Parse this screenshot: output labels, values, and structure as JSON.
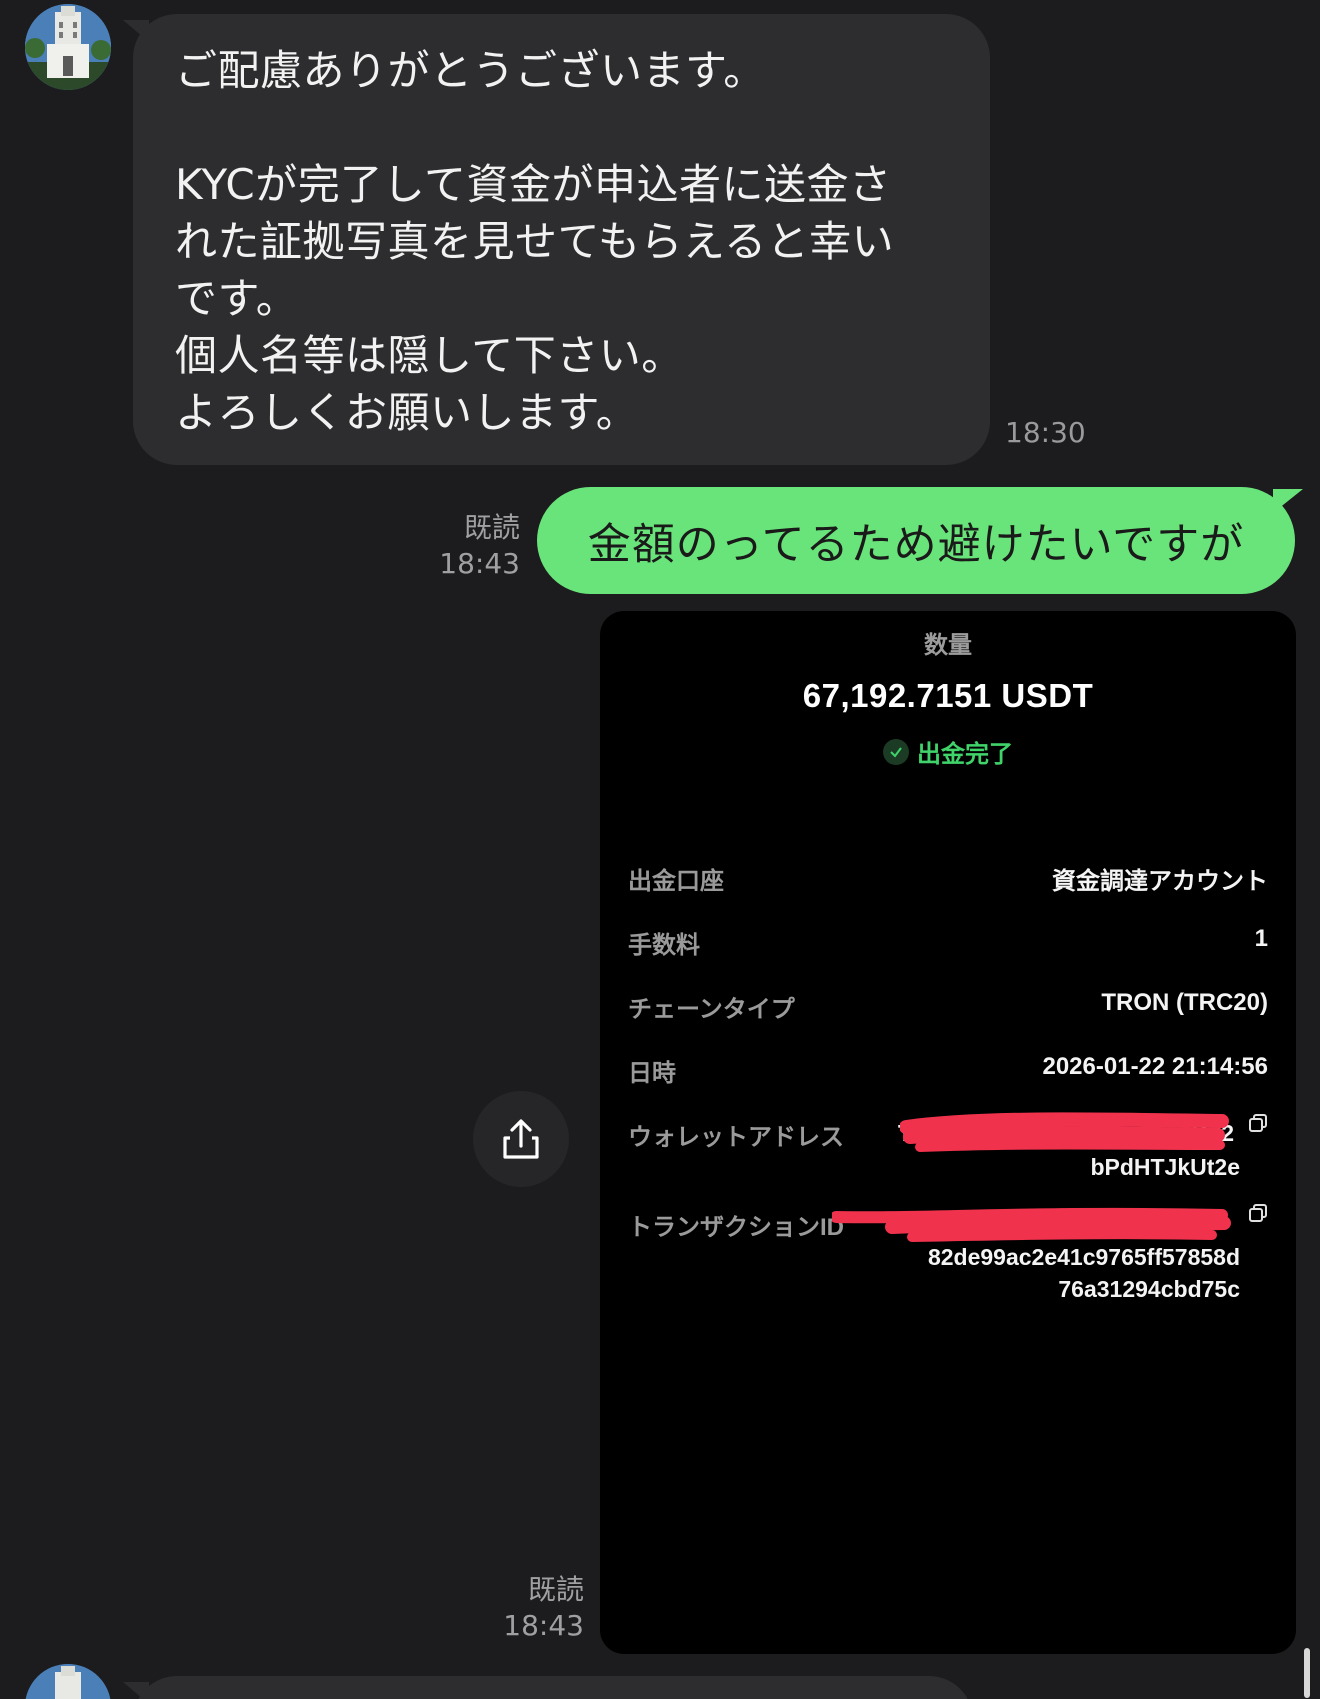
{
  "incoming": {
    "lines": [
      "ご配慮ありがとうございます。",
      "",
      "KYCが完了して資金が申込者に送金さ",
      "れた証拠写真を見せてもらえると幸い",
      "です。",
      "個人名等は隠して下さい。",
      "よろしくお願いします。"
    ],
    "time": "18:30"
  },
  "outgoing_text": {
    "text": "金額のってるため避けたいですが",
    "read_label": "既読",
    "time": "18:43"
  },
  "outgoing_image": {
    "read_label": "既読",
    "time": "18:43"
  },
  "receipt": {
    "quantity_label": "数量",
    "amount": "67,192.7151 USDT",
    "status": "出金完了",
    "rows": [
      {
        "label": "出金口座",
        "value": "資金調達アカウント"
      },
      {
        "label": "手数料",
        "value": "1"
      },
      {
        "label": "チェーンタイプ",
        "value": "TRON (TRC20)"
      },
      {
        "label": "日時",
        "value": "2026-01-22 21:14:56"
      }
    ],
    "wallet": {
      "label": "ウォレットアドレス",
      "line1": "T",
      "line1_tail": "B72",
      "line2": "bPdHTJkUt2e"
    },
    "txid": {
      "label": "トランザクションID",
      "line2": "82de99ac2e41c9765ff57858d",
      "line3": "76a31294cbd75c"
    }
  },
  "colors": {
    "background": "#1c1c1e",
    "incoming_bubble": "#2d2d2f",
    "outgoing_bubble": "#69e47a",
    "status_green": "#3fd36a",
    "redaction": "#f0324d"
  },
  "icons": [
    "avatar-building",
    "share-icon",
    "check-circle-icon",
    "copy-icon"
  ]
}
